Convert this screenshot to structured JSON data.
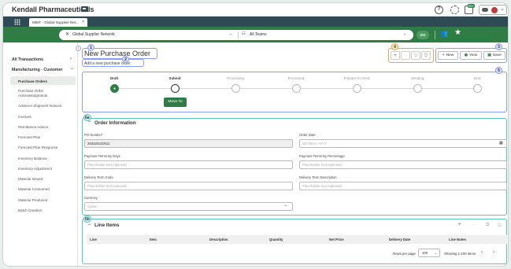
{
  "app": {
    "company": "Kendall Pharmaceuticals",
    "tab": "MINT - Global Supplier Net...",
    "tab_close": "×",
    "notif_count": "99+"
  },
  "filter": {
    "network": "Global Supplier Network",
    "teams": "All Teams",
    "go": "GO"
  },
  "sidebar": {
    "sections": [
      {
        "label": "All Transactions",
        "caret": "›"
      },
      {
        "label": "Manufacturing - Customer",
        "caret": "⌄"
      }
    ],
    "items": [
      "Purchase Orders",
      "Purchase Order Acknowledgments",
      "Advance Shipment Notices",
      "Invoices",
      "Remittance Advice",
      "Forecast Plan",
      "Forecast Plan Response",
      "Inventory Balance",
      "Inventory Adjustment",
      "Material Issued",
      "Material Consumed",
      "Material Produced",
      "Batch Creation"
    ],
    "active_index": 0,
    "collapse": "‹"
  },
  "page": {
    "title": "New Purchase Order",
    "subtitle": "Add a new purchase order."
  },
  "badges": {
    "b1": "1",
    "b2": "2",
    "b3": "3",
    "b4": "4",
    "b5": "5",
    "b6a": "6a",
    "b6b": "6b"
  },
  "toolbar": {
    "new": "New",
    "view": "View",
    "save": "Save",
    "icons": [
      "plus-icon",
      "minus-icon",
      "copy-icon",
      "delete-icon"
    ]
  },
  "stepper": {
    "steps": [
      "Draft",
      "Submit",
      "Processing",
      "Processed",
      "Prepare To Send",
      "Sending",
      "Sent"
    ],
    "done_index": 0,
    "current_index": 1,
    "move_button": "Move To"
  },
  "order_info": {
    "title": "Order Information",
    "fields": {
      "po_number": {
        "label": "PO Number*",
        "value": "260320210011"
      },
      "order_date": {
        "label": "Order Date",
        "placeholder": "DD Mmm YYYY"
      },
      "terms_days": {
        "label": "Payment Terms By Days",
        "placeholder": "Placeholder text (optional)"
      },
      "terms_pct": {
        "label": "Payment Terms By Percentage",
        "placeholder": "Placeholder text (optional)"
      },
      "delivery_code": {
        "label": "Delivery Term Code",
        "placeholder": "Placeholder text (optional)"
      },
      "delivery_desc": {
        "label": "Delivery Term Description",
        "placeholder": "Placeholder text (optional)"
      },
      "currency": {
        "label": "Currency",
        "placeholder": "Option"
      }
    }
  },
  "line_items": {
    "title": "Line Items",
    "columns": [
      "Line",
      "Item",
      "Description",
      "Quantity",
      "Net Price",
      "Delivery Date",
      "Line Notes"
    ],
    "rows_per_page_label": "Rows per page",
    "rows_per_page": "100",
    "range": "Showing 1-100 items"
  },
  "colors": {
    "brand_green": "#2f7d44",
    "nav_dark": "#2e4a55",
    "annotation_blue": "#8a9ff2",
    "annotation_orange": "#f0a247",
    "annotation_teal": "#58c7c2"
  }
}
